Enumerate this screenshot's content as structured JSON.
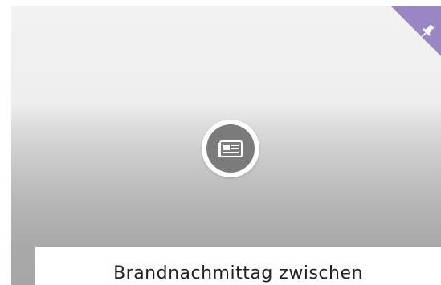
{
  "card": {
    "title": "Brandnachmittag zwischen",
    "type_icon": "newspaper-icon",
    "corner_icon": "pin-icon"
  },
  "colors": {
    "ribbon": "#9a86c4",
    "icon_circle": "#7b7b7b",
    "title_text": "#222222"
  }
}
